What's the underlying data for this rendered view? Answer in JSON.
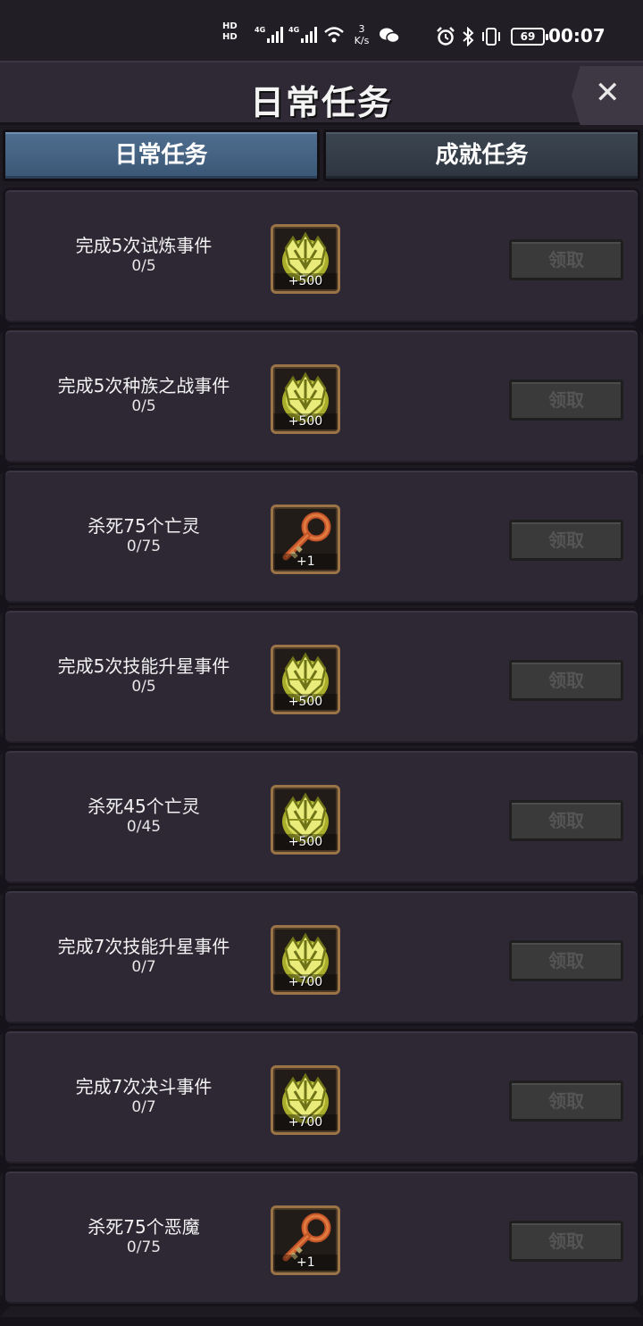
{
  "status_bar": {
    "hd1": "HD",
    "hd2": "HD",
    "net1": "4G",
    "net2": "4G",
    "speed_value": "3",
    "speed_unit": "K/s",
    "battery": "69",
    "time": "00:07"
  },
  "header": {
    "title": "日常任务",
    "close": "✕"
  },
  "tabs": [
    {
      "label": "日常任务",
      "active": true
    },
    {
      "label": "成就任务",
      "active": false
    }
  ],
  "claim_label": "领取",
  "quests": [
    {
      "name": "完成5次试炼事件",
      "progress": "0/5",
      "reward_icon": "crest-icon",
      "reward_qty": "+500"
    },
    {
      "name": "完成5次种族之战事件",
      "progress": "0/5",
      "reward_icon": "crest-icon",
      "reward_qty": "+500"
    },
    {
      "name": "杀死75个亡灵",
      "progress": "0/75",
      "reward_icon": "key-icon",
      "reward_qty": "+1"
    },
    {
      "name": "完成5次技能升星事件",
      "progress": "0/5",
      "reward_icon": "crest-icon",
      "reward_qty": "+500"
    },
    {
      "name": "杀死45个亡灵",
      "progress": "0/45",
      "reward_icon": "crest-icon",
      "reward_qty": "+500"
    },
    {
      "name": "完成7次技能升星事件",
      "progress": "0/7",
      "reward_icon": "crest-icon",
      "reward_qty": "+700"
    },
    {
      "name": "完成7次决斗事件",
      "progress": "0/7",
      "reward_icon": "crest-icon",
      "reward_qty": "+700"
    },
    {
      "name": "杀死75个恶魔",
      "progress": "0/75",
      "reward_icon": "key-icon",
      "reward_qty": "+1"
    }
  ],
  "colors": {
    "tab_active": "#4f6f90",
    "tab_inactive": "#3b4550",
    "card_bg": "#2e2834",
    "claim_disabled_bg": "#3a3a3a",
    "reward_border": "#9a7446"
  }
}
